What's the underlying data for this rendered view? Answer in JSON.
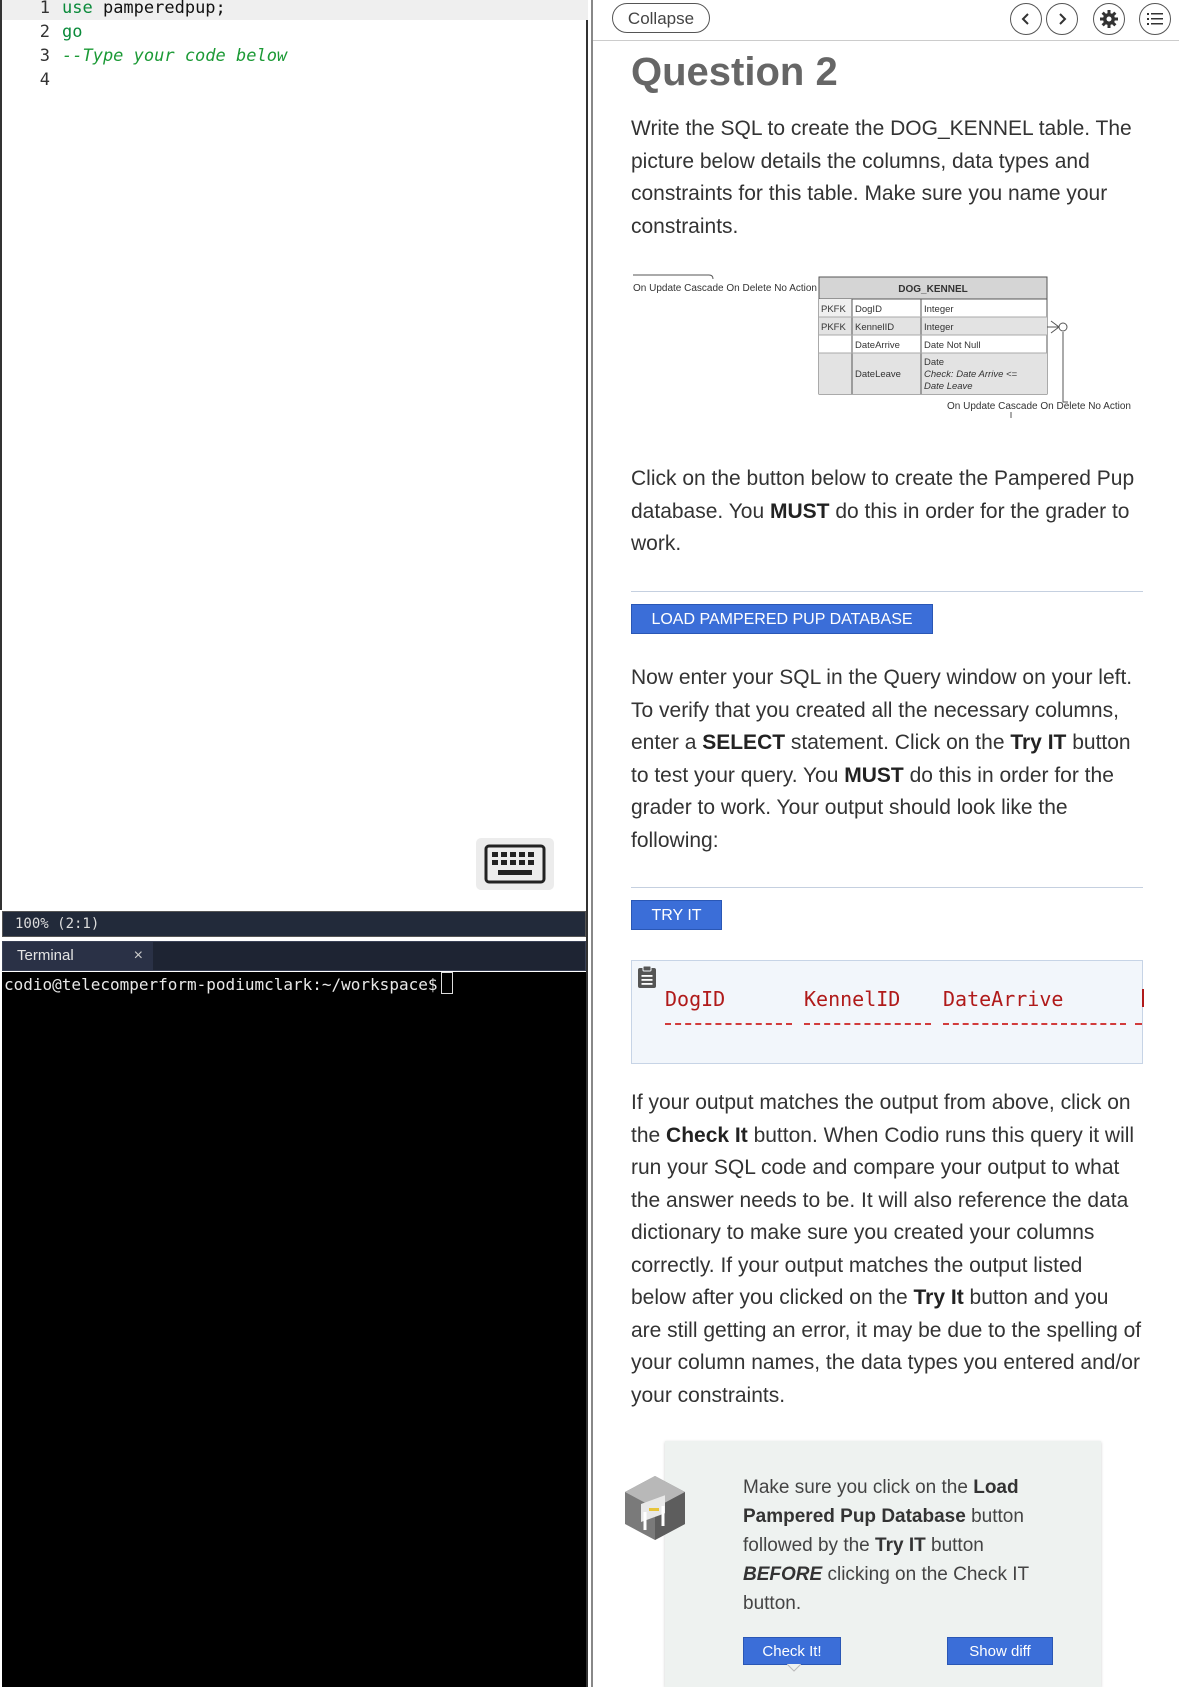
{
  "editor": {
    "lines": [
      {
        "num": "1",
        "kw": "use",
        "rest": " pamperedpup;"
      },
      {
        "num": "2",
        "kw": "go"
      },
      {
        "num": "3",
        "comment": "--Type your code below"
      },
      {
        "num": "4"
      }
    ]
  },
  "status_bar": {
    "text": "100%  (2:1)"
  },
  "terminal": {
    "tab_label": "Terminal",
    "close": "×",
    "prompt": "codio@telecomperform-podiumclark:~/workspace$"
  },
  "guide": {
    "collapse_label": "Collapse",
    "title": "Question 2",
    "intro": "Write the SQL to create the DOG_KENNEL table. The picture below details the columns, data types and constraints for this table. Make sure you name your constraints.",
    "diagram": {
      "table_name": "DOG_KENNEL",
      "left_relationship": "On Update Cascade On Delete No Action",
      "right_relationship": "On Update Cascade On Delete No Action",
      "rows": [
        {
          "key": "PKFK",
          "column": "DogID",
          "type": "Integer"
        },
        {
          "key": "PKFK",
          "column": "KennelID",
          "type": "Integer"
        },
        {
          "key": "",
          "column": "DateArrive",
          "type": "Date Not Null"
        },
        {
          "key": "",
          "column": "DateLeave",
          "type_line1": "Date",
          "type_line2": "Check:  Date Arrive <=",
          "type_line3": "Date Leave"
        }
      ]
    },
    "load_para": {
      "part1": "Click on the button below to create the Pampered Pup database. You ",
      "bold1": "MUST",
      "part2": " do this in order for the grader to work."
    },
    "load_button": "LOAD PAMPERED PUP DATABASE",
    "query_para": {
      "p1": "Now enter your SQL in the Query window on your left. To verify that you created all the necessary columns, enter a ",
      "b1": "SELECT",
      "p2": " statement. Click on the ",
      "b2": "Try IT",
      "p3": " button to test your query. You ",
      "b3": "MUST",
      "p4": " do this in order for the grader to work. Your output should look like the following:"
    },
    "try_button": "TRY IT",
    "output_headers": [
      "DogID",
      "KennelID",
      "DateArrive"
    ],
    "check_para": {
      "p1": "If your output matches the output from above, click on the ",
      "b1": "Check It",
      "p2": " button. When Codio runs this query it will run your SQL code and compare your output to what the answer needs to be. It will also reference the data dictionary to make sure you created your columns correctly. If your output matches the output listed below after you clicked on the ",
      "b2": "Try It",
      "p3": " button and you are still getting an error, it may be due to the spelling of your column names, the data types you entered and/or your constraints."
    },
    "note": {
      "p1": "Make sure you click on the ",
      "b1": "Load Pampered Pup Database",
      "p2": " button followed by the ",
      "b2": "Try IT",
      "p3": " button ",
      "b3": "BEFORE",
      "p4": " clicking on the Check IT button."
    },
    "check_button": "Check It!",
    "diff_button": "Show diff"
  }
}
